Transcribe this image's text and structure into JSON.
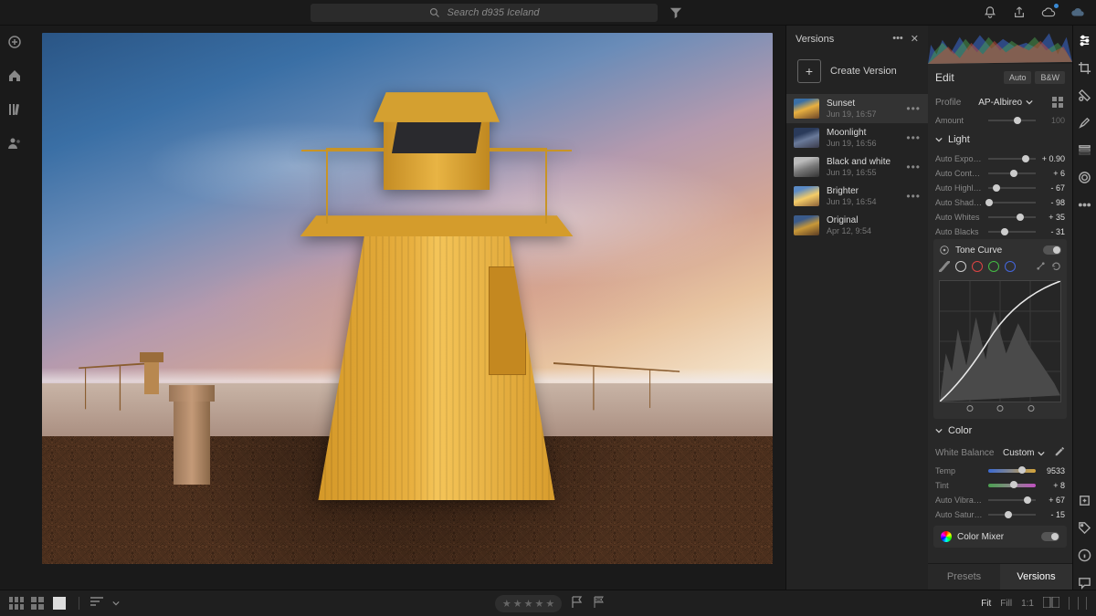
{
  "search": {
    "placeholder": "Search d935 Iceland"
  },
  "versions_panel": {
    "title": "Versions",
    "create_label": "Create Version",
    "items": [
      {
        "name": "Sunset",
        "date": "Jun 19, 16:57",
        "thumb_style": "linear-gradient(160deg,#3a6fa5 20%,#e8b040 50%,#6b4528)"
      },
      {
        "name": "Moonlight",
        "date": "Jun 19, 16:56",
        "thumb_style": "linear-gradient(160deg,#2a3a5a 30%,#6a7a9a 55%,#3a3a4a)"
      },
      {
        "name": "Black and white",
        "date": "Jun 19, 16:55",
        "thumb_style": "linear-gradient(160deg,#bbb 25%,#777 55%,#333)"
      },
      {
        "name": "Brighter",
        "date": "Jun 19, 16:54",
        "thumb_style": "linear-gradient(160deg,#5a8ac5 20%,#f4cc68 55%,#8a6038)"
      },
      {
        "name": "Original",
        "date": "Apr 12, 9:54",
        "thumb_style": "linear-gradient(160deg,#3a5a8a 25%,#c89838 55%,#5a3c24)"
      }
    ]
  },
  "edit_panel": {
    "title": "Edit",
    "auto_btn": "Auto",
    "bw_btn": "B&W",
    "profile_label": "Profile",
    "profile_value": "AP-Albireo",
    "amount_label": "Amount",
    "amount_value": "100",
    "light": {
      "title": "Light",
      "sliders": [
        {
          "label": "Auto Expos…",
          "value": "+ 0.90",
          "pct": 78
        },
        {
          "label": "Auto Contr…",
          "value": "+ 6",
          "pct": 53
        },
        {
          "label": "Auto Highli…",
          "value": "- 67",
          "pct": 18
        },
        {
          "label": "Auto Shad…",
          "value": "- 98",
          "pct": 2
        },
        {
          "label": "Auto Whites",
          "value": "+ 35",
          "pct": 67
        },
        {
          "label": "Auto Blacks",
          "value": "- 31",
          "pct": 35
        }
      ]
    },
    "tone_curve": {
      "title": "Tone Curve"
    },
    "color": {
      "title": "Color",
      "wb_label": "White Balance",
      "wb_value": "Custom",
      "temp_label": "Temp",
      "temp_value": "9533",
      "temp_pct": 72,
      "tint_label": "Tint",
      "tint_value": "+ 8",
      "tint_pct": 54,
      "vibrance_label": "Auto Vibra…",
      "vibrance_value": "+ 67",
      "vibrance_pct": 83,
      "saturation_label": "Auto Satur…",
      "saturation_value": "- 15",
      "saturation_pct": 42
    },
    "color_mixer": "Color Mixer",
    "tabs": {
      "presets": "Presets",
      "versions": "Versions"
    }
  },
  "bottombar": {
    "zoom": {
      "fit": "Fit",
      "fill": "Fill",
      "one": "1:1"
    }
  }
}
